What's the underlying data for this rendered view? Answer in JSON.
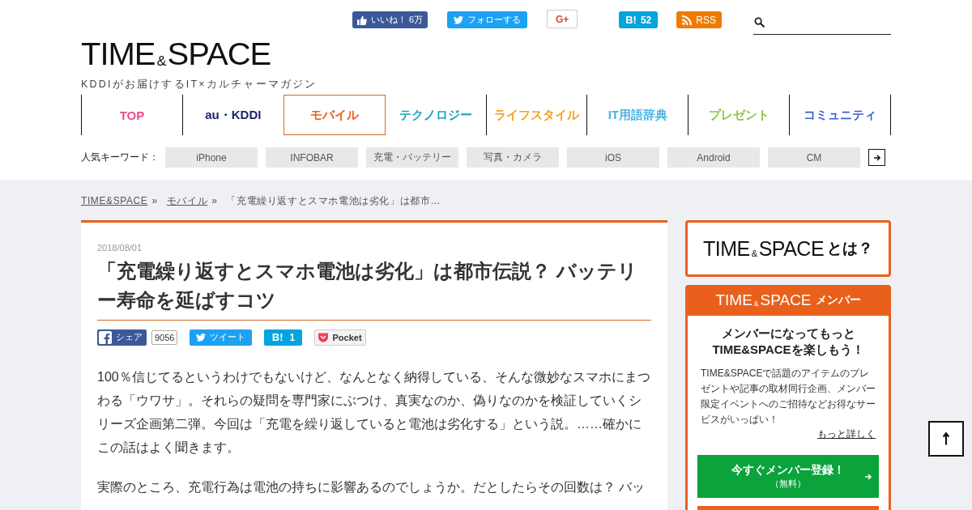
{
  "social": [
    {
      "kind": "facebook",
      "label": "いいね！ 6万"
    },
    {
      "kind": "twitter",
      "label": "フォローする"
    },
    {
      "kind": "googleplus",
      "label": "G+"
    },
    {
      "kind": "hatena",
      "label": "B!",
      "count": "52"
    },
    {
      "kind": "rss",
      "label": "RSS"
    }
  ],
  "logo": {
    "text": "TIME$_{&}$SPACE",
    "tagline": "KDDIがお届けするIT×カルチャーマガジン"
  },
  "nav": [
    {
      "label": "TOP",
      "color": "#e8508c",
      "selected": false
    },
    {
      "label": "au・KDDI",
      "color": "#1c2370",
      "selected": false
    },
    {
      "label": "モバイル",
      "color": "#e8601c",
      "selected": true
    },
    {
      "label": "テクノロジー",
      "color": "#16a3c4",
      "selected": false
    },
    {
      "label": "ライフスタイル",
      "color": "#f2a020",
      "selected": false
    },
    {
      "label": "IT用語辞典",
      "color": "#48b4e6",
      "selected": false
    },
    {
      "label": "プレゼント",
      "color": "#8cc63f",
      "selected": false
    },
    {
      "label": "コミュニティ",
      "color": "#3a62d4",
      "selected": false
    }
  ],
  "keywords": {
    "label": "人気キーワード：",
    "items": [
      "iPhone",
      "INFOBAR",
      "充電・バッテリー",
      "写真・カメラ",
      "iOS",
      "Android",
      "CM"
    ]
  },
  "breadcrumb": [
    {
      "label": "TIME&SPACE",
      "kind": "link",
      "separator": "»"
    },
    {
      "label": "モバイル",
      "kind": "link",
      "separator": "»"
    },
    {
      "label": "「充電繰り返すとスマホ電池は劣化」は都市…",
      "kind": "current"
    }
  ],
  "article": {
    "date": "2018/08/01",
    "title": "「充電繰り返すとスマホ電池は劣化」は都市伝説？ バッテリー寿命を延ばすコツ",
    "share": [
      {
        "kind": "facebook",
        "label": "シェア",
        "count": "9056"
      },
      {
        "kind": "twitter",
        "label": "ツイート"
      },
      {
        "kind": "hatena",
        "label": "B!",
        "count": "1"
      },
      {
        "kind": "pocket",
        "label": "Pocket"
      }
    ],
    "paragraphs": [
      "100％信じてるというわけでもないけど、なんとなく納得している、そんな微妙なスマホにまつわる「ウワサ」。それらの疑問を専門家にぶつけ、真実なのか、偽りなのかを検証していくシリーズ企画第二弾。今回は「充電を繰り返していると電池は劣化する」という説。……確かにこの話はよく聞きます。",
      "実際のところ、充電行為は電池の持ちに影響あるのでしょうか。だとしたらその回数は？ バッ"
    ]
  },
  "sidebar": {
    "about": {
      "logo": "TIME$_{&}$SPACE",
      "suffix": "とは？"
    },
    "member": {
      "logo": "TIME$_{&}$SPACE",
      "suffix": "メンバー",
      "heading": [
        "メンバーになってもっと",
        "TIME&SPACEを楽しもう！"
      ],
      "body": "TIME&SPACEで話題のアイテムのプレゼントや記事の取材同行企画、メンバー限定イベントへのご招待などお得なサービスがいっぱい！",
      "more_link": "もっと詳しく",
      "register": {
        "label": "今すぐメンバー登録！",
        "note": "（無料）"
      }
    }
  }
}
